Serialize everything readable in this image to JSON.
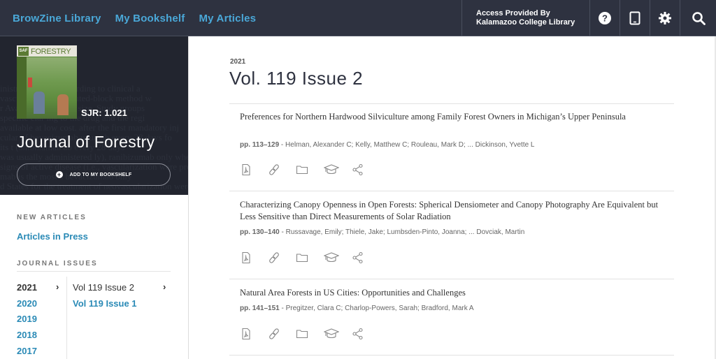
{
  "topbar": {
    "nav": [
      "BrowZine Library",
      "My Bookshelf",
      "My Articles"
    ],
    "access_line1": "Access Provided By",
    "access_line2": "Kalamazoo College Library",
    "icons": [
      "help-icon",
      "device-icon",
      "settings-icon",
      "search-icon"
    ]
  },
  "journal": {
    "cover_title": "FORESTRY",
    "cover_title_small": "Journal of",
    "cover_logo": "SAF",
    "sjr": "SJR: 1.021",
    "title": "Journal of Forestry",
    "add_button": "ADD TO MY BOOKSHELF",
    "ghost_text": [
      "inistra  ulat  ified according to clinical a",
      "vascula  label  a permuted-block method w",
      "r Avast  , no   ter block size. Study groups",
      "specific  ciar  ing to the drug and the regi",
      "available at low cost.  after the first mandatory inj",
      "cular  of  beyacizumab  uzumab every 28 days fo",
      "its  t  (anibizumab  ab every 28 days",
      "was usually administered  ly), ranibizumab only when",
      "signs of active disease (i.e.,  vascularization were present",
      "mab is the most  s  bevacizumab only",
      "d States for the treatment of  neovascularization were pre"
    ]
  },
  "sidebar": {
    "new_articles_label": "NEW ARTICLES",
    "articles_in_press": "Articles in Press",
    "journal_issues_label": "JOURNAL ISSUES",
    "years": [
      "2021",
      "2020",
      "2019",
      "2018",
      "2017"
    ],
    "selected_year": "2021",
    "issues": [
      "Vol 119 Issue 2",
      "Vol 119 Issue 1"
    ],
    "selected_issue": "Vol 119 Issue 2",
    "chevron": "›"
  },
  "main": {
    "year": "2021",
    "title": "Vol. 119 Issue 2",
    "articles": [
      {
        "title": "Preferences for Northern Hardwood Silviculture among Family Forest Owners in Michigan’s Upper Peninsula",
        "pages": "pp. 113–129",
        "separator": " - ",
        "authors": "Helman, Alexander C; Kelly, Matthew C; Rouleau, Mark D; ... Dickinson, Yvette L"
      },
      {
        "title": "Characterizing Canopy Openness in Open Forests: Spherical Densiometer and Canopy Photography Are Equivalent but Less Sensitive than Direct Measurements of Solar Radiation",
        "pages": "pp. 130–140",
        "separator": " - ",
        "authors": "Russavage, Emily; Thiele, Jake; Lumbsden-Pinto, Joanna; ... Dovciak, Martin"
      },
      {
        "title": "Natural Area Forests in US Cities: Opportunities and Challenges",
        "pages": "pp. 141–151",
        "separator": " - ",
        "authors": "Pregitzer, Clara C; Charlop-Powers, Sarah; Bradford, Mark A"
      }
    ],
    "article_actions": [
      "pdf-icon",
      "link-icon",
      "folder-icon",
      "academic-cap-icon",
      "share-icon"
    ]
  },
  "colors": {
    "topbar_bg": "#2e3240",
    "sidebar_head_bg": "#22252f",
    "link_blue": "#2a8ab6",
    "nav_blue": "#4aa8d8"
  }
}
